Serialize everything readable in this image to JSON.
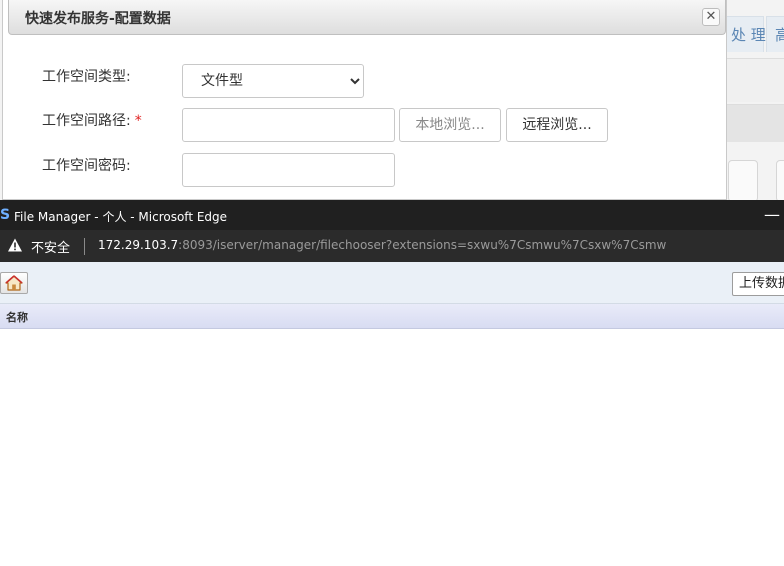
{
  "background_app": {
    "tabs": [
      "处 理",
      "高"
    ]
  },
  "dialog": {
    "title": "快速发布服务-配置数据",
    "close_glyph": "✕",
    "form": {
      "workspace_type_label": "工作空间类型:",
      "workspace_type_value": "文件型",
      "workspace_type_options": [
        "文件型"
      ],
      "workspace_path_label": "工作空间路径:",
      "required_marker": "*",
      "workspace_path_value": "",
      "local_browse_label": "本地浏览...",
      "remote_browse_label": "远程浏览...",
      "workspace_password_label": "工作空间密码:",
      "workspace_password_value": ""
    }
  },
  "popup_window": {
    "logo_letter": "S",
    "title": "File Manager - 个人 - Microsoft Edge",
    "minimize_glyph": "—",
    "address_bar": {
      "security_label": "不安全",
      "url_host": "172.29.103.7",
      "url_rest": ":8093/iserver/manager/filechooser?extensions=sxwu%7Csmwu%7Csxw%7Csmw"
    },
    "toolbar": {
      "upload_label": "上传数据"
    },
    "file_list": {
      "column_name": "名称",
      "rows": []
    }
  },
  "colors": {
    "titlebar_dark": "#202020",
    "addressbar_dark": "#2b2b2b",
    "toolbar_bg": "#eaf0f7",
    "header_bg": "#dde1f5",
    "required": "#e02020",
    "tab_text": "#5b86b4"
  },
  "icons": {
    "home_button": "home-icon",
    "security": "warning-icon",
    "close": "close-icon"
  }
}
